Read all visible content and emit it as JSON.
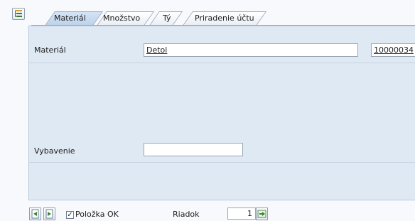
{
  "tabs": [
    {
      "label": "Materiál",
      "active": true
    },
    {
      "label": "Množstvo",
      "active": false
    },
    {
      "label": "Tý",
      "active": false
    },
    {
      "label": "Priradenie účtu",
      "active": false
    }
  ],
  "form": {
    "material_label": "Materiál",
    "material_value": "Detol",
    "material_number": "10000034",
    "equipment_label": "Vybavenie",
    "equipment_value": ""
  },
  "footer": {
    "item_ok_label": "Položka OK",
    "item_ok_checked": true,
    "line_label": "Riadok",
    "line_value": "1"
  },
  "icons": {
    "tree": "tree-toggle-icon",
    "prev": "previous-item-icon",
    "next": "next-item-icon",
    "goto": "go-to-line-icon"
  },
  "colors": {
    "panel": "#dfe9f4",
    "active_tab": "#c9dcf0",
    "border": "#9aa9ba"
  }
}
